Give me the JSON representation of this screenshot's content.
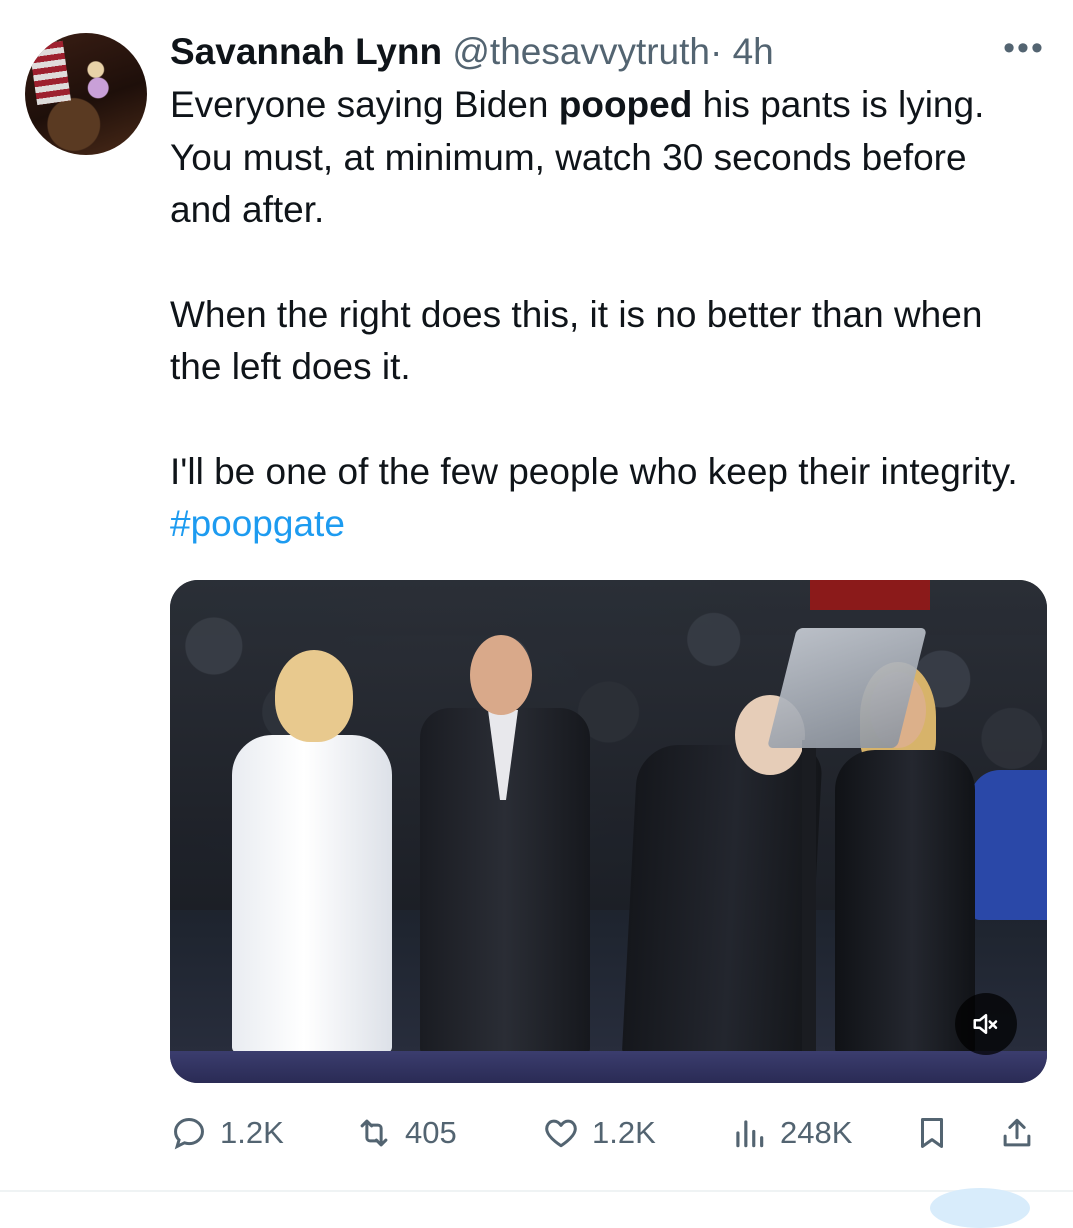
{
  "tweet": {
    "author_name": "Savannah Lynn",
    "handle": "@thesavvytruth",
    "separator": "·",
    "time": "4h",
    "more_label": "•••",
    "text": {
      "p1_a": "Everyone saying Biden ",
      "p1_bold": "pooped",
      "p1_b": " his pants is lying. You must, at minimum, watch 30 seconds before and after.",
      "p2": "When the right does this, it is no better than when the left does it.",
      "p3_a": "I'll be one of the few people who keep their integrity. ",
      "p3_hashtag": "#poopgate"
    }
  },
  "media": {
    "type": "video",
    "muted": true
  },
  "actions": {
    "replies": "1.2K",
    "reposts": "405",
    "likes": "1.2K",
    "views": "248K"
  },
  "colors": {
    "text": "#0f1419",
    "secondary": "#536471",
    "link": "#1d9bf0"
  }
}
